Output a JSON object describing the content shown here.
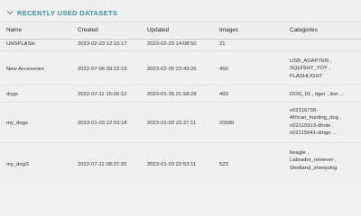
{
  "section": {
    "title": "RECENTLY USED DATASETS"
  },
  "table": {
    "headers": {
      "name": "Name",
      "created": "Created",
      "updated": "Updated",
      "images": "Images",
      "categories": "Categories"
    },
    "rows": [
      {
        "name": "UNSPLASH",
        "created": "2023-02-23 12:15:17",
        "updated": "2023-02-23 14:08:50",
        "images": "21",
        "categories": [
          ""
        ]
      },
      {
        "name": "New Accesories",
        "created": "2022-07-05 09:22:19",
        "updated": "2023-02-05 23:43:26",
        "images": "450",
        "categories": [
          "USB_ADAPTER ,",
          "SQUISHY_TOY ,",
          "FLASHLIGHT"
        ]
      },
      {
        "name": "dogs",
        "created": "2022-07-11 15:00:12",
        "updated": "2023-01-26 21:58:28",
        "images": "493",
        "categories": [
          "DOG_01 , tiger , lion ..."
        ]
      },
      {
        "name": "my_dogs",
        "created": "2023-01-03 22:53:18",
        "updated": "2023-01-03 23:27:11",
        "images": "20580",
        "categories": [
          "n02116738-",
          "African_hunting_dog ,",
          "n02115913-dhole ,",
          "n02115641-dingo ..."
        ]
      },
      {
        "name": "my_dogS",
        "created": "2022-07-11 08:37:20",
        "updated": "2023-01-03 22:53:11",
        "images": "523",
        "categories": [
          "beagle ,",
          "Labrador_retriever ,",
          "Shetland_sheepdog"
        ]
      }
    ]
  },
  "colors": {
    "accent": "#3a8fa3",
    "background": "#efefef"
  }
}
